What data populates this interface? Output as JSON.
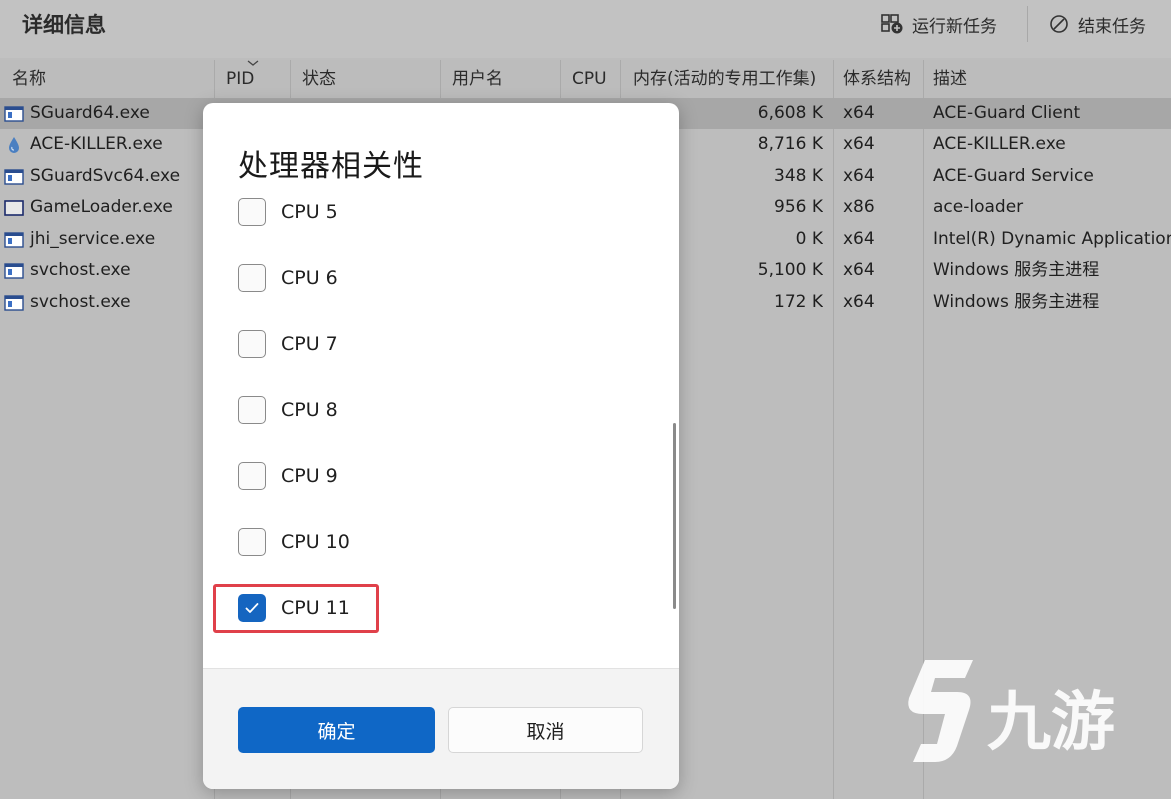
{
  "header": {
    "title": "详细信息",
    "run_new_task": "运行新任务",
    "end_task": "结束任务"
  },
  "columns": [
    "名称",
    "PID",
    "状态",
    "用户名",
    "CPU",
    "内存(活动的专用工作集)",
    "体系结构",
    "描述"
  ],
  "processes": [
    {
      "name": "SGuard64.exe",
      "icon": "app-window-icon",
      "memory": "6,608 K",
      "arch": "x64",
      "desc": "ACE-Guard Client",
      "selected": true
    },
    {
      "name": "ACE-KILLER.exe",
      "icon": "drop-icon",
      "memory": "8,716 K",
      "arch": "x64",
      "desc": "ACE-KILLER.exe"
    },
    {
      "name": "SGuardSvc64.exe",
      "icon": "app-window-icon",
      "memory": "348 K",
      "arch": "x64",
      "desc": "ACE-Guard Service"
    },
    {
      "name": "GameLoader.exe",
      "icon": "blank-window-icon",
      "memory": "956 K",
      "arch": "x86",
      "desc": "ace-loader"
    },
    {
      "name": "jhi_service.exe",
      "icon": "app-window-icon",
      "memory": "0 K",
      "arch": "x64",
      "desc": "Intel(R) Dynamic Application"
    },
    {
      "name": "svchost.exe",
      "icon": "app-window-icon",
      "memory": "5,100 K",
      "arch": "x64",
      "desc": "Windows 服务主进程"
    },
    {
      "name": "svchost.exe",
      "icon": "app-window-icon",
      "memory": "172 K",
      "arch": "x64",
      "desc": "Windows 服务主进程"
    }
  ],
  "dialog": {
    "title": "处理器相关性",
    "cpus": [
      {
        "label": "CPU 5",
        "checked": false
      },
      {
        "label": "CPU 6",
        "checked": false
      },
      {
        "label": "CPU 7",
        "checked": false
      },
      {
        "label": "CPU 8",
        "checked": false
      },
      {
        "label": "CPU 9",
        "checked": false
      },
      {
        "label": "CPU 10",
        "checked": false
      },
      {
        "label": "CPU 11",
        "checked": true
      }
    ],
    "ok_label": "确定",
    "cancel_label": "取消"
  },
  "watermark": {
    "text": "九游"
  },
  "colors": {
    "accent": "#0f67c6",
    "highlight": "#e0404a"
  }
}
